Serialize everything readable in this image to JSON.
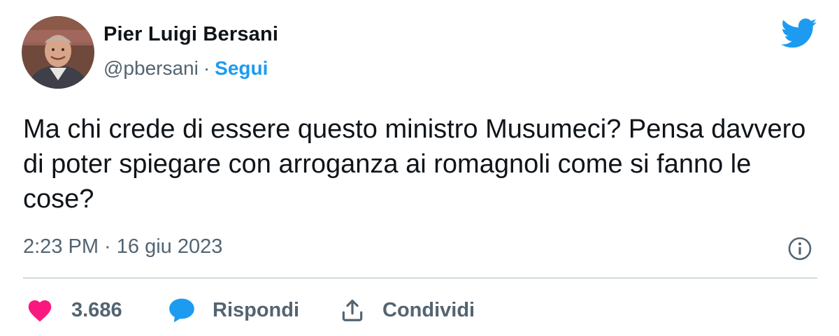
{
  "author": {
    "display_name": "Pier Luigi Bersani",
    "handle": "@pbersani",
    "separator": "·",
    "follow_label": "Segui"
  },
  "tweet": {
    "text": "Ma chi crede di essere questo ministro Musumeci? Pensa davvero di poter spiegare con arroganza ai romagnoli come si fanno le cose?",
    "timestamp": "2:23 PM · 16 giu 2023"
  },
  "actions": {
    "like_count": "3.686",
    "reply_label": "Rispondi",
    "share_label": "Condividi"
  },
  "icons": {
    "brand": "twitter-bird-icon",
    "info": "info-icon",
    "like": "heart-icon",
    "reply": "speech-bubble-icon",
    "share": "share-upload-icon"
  },
  "colors": {
    "brand_blue": "#1d9bf0",
    "like_pink": "#f91880",
    "secondary_text": "#536471",
    "primary_text": "#0f1419",
    "divider": "#cfd9de"
  }
}
